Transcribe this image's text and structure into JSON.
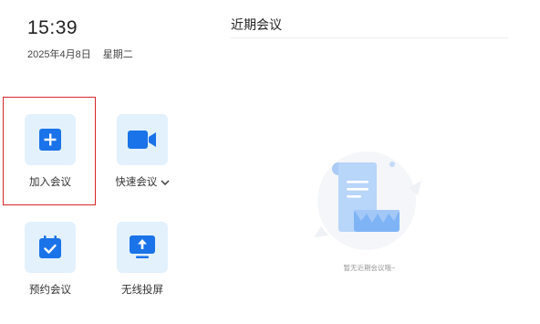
{
  "clock": {
    "time": "15:39",
    "date": "2025年4月8日",
    "weekday": "星期二"
  },
  "actions": {
    "join": {
      "label": "加入会议",
      "icon": "plus-icon"
    },
    "quick": {
      "label": "快速会议",
      "icon": "video-camera-icon",
      "caret": "chevron-down-icon"
    },
    "schedule": {
      "label": "预约会议",
      "icon": "calendar-check-icon"
    },
    "screen": {
      "label": "无线投屏",
      "icon": "screen-share-icon"
    }
  },
  "meetings": {
    "title": "近期会议",
    "empty_text": "暂无近期会议哦~"
  },
  "colors": {
    "accent": "#1a73e8",
    "tile_bg": "#e3f1fd",
    "highlight": "#d9252a"
  }
}
